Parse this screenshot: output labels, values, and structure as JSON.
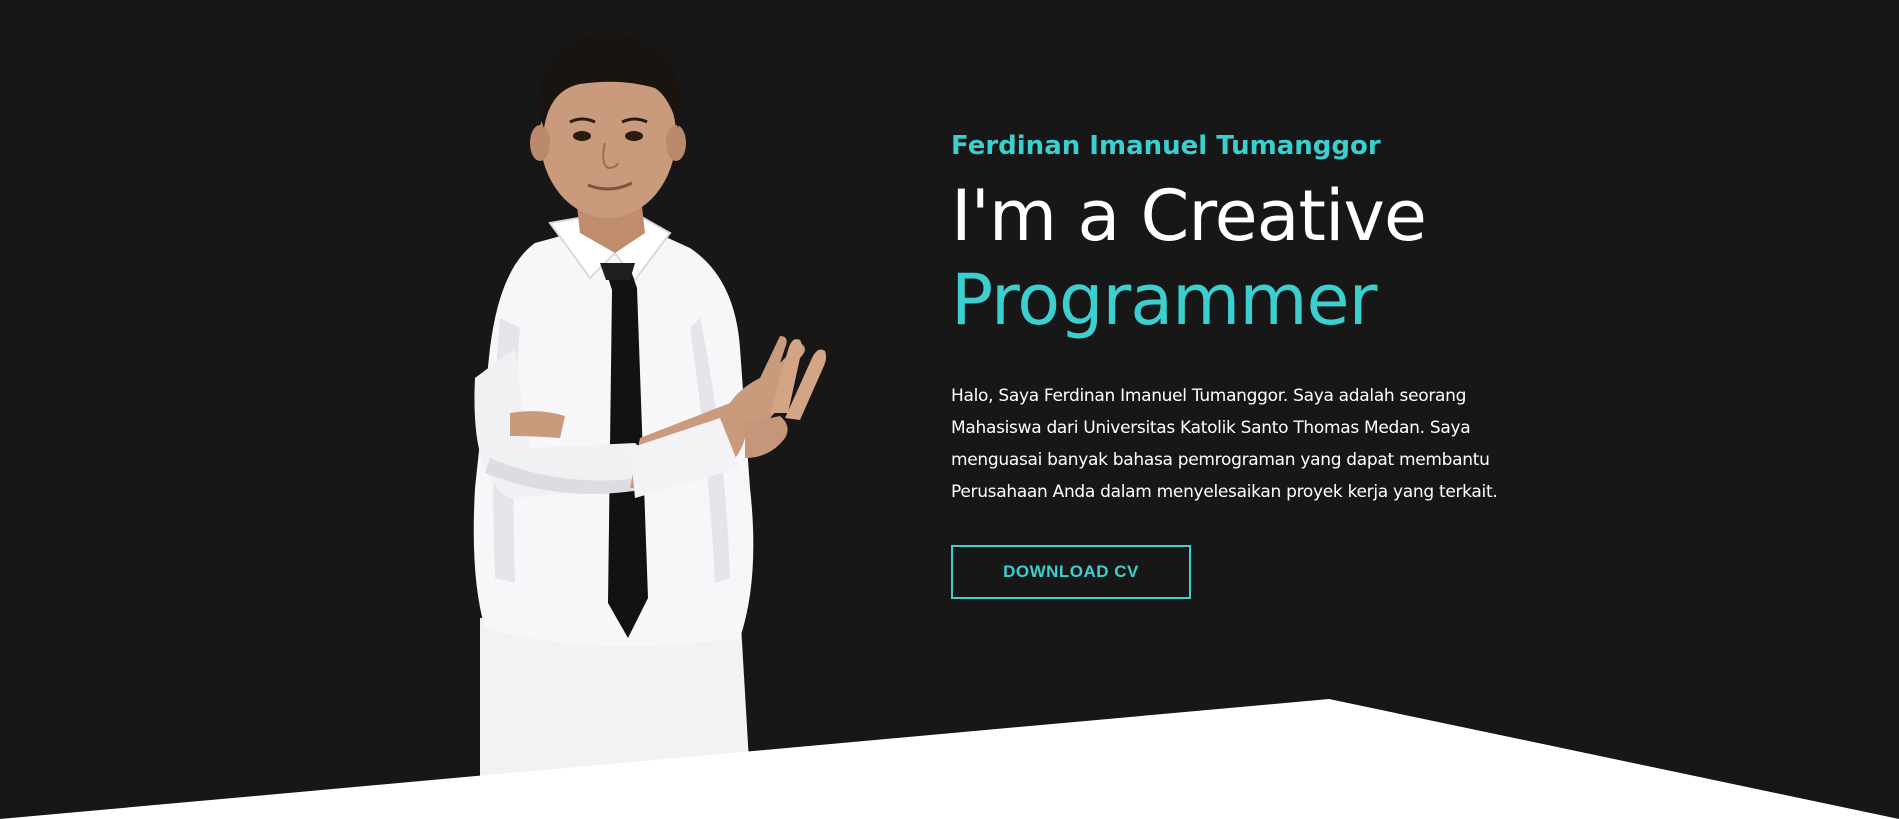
{
  "hero": {
    "name": "Ferdinan Imanuel Tumanggor",
    "headline_main": "I'm a Creative",
    "headline_accent": "Programmer",
    "bio": "Halo, Saya Ferdinan Imanuel Tumanggor. Saya adalah seorang Mahasiswa dari Universitas Katolik Santo Thomas Medan. Saya menguasai banyak bahasa pemrograman yang dapat membantu Perusahaan Anda dalam menyelesaikan proyek kerja yang terkait.",
    "cta_label": "DOWNLOAD CV"
  },
  "colors": {
    "background": "#171717",
    "accent": "#3ccfcf",
    "text": "#ffffff",
    "shape": "#ffffff"
  }
}
